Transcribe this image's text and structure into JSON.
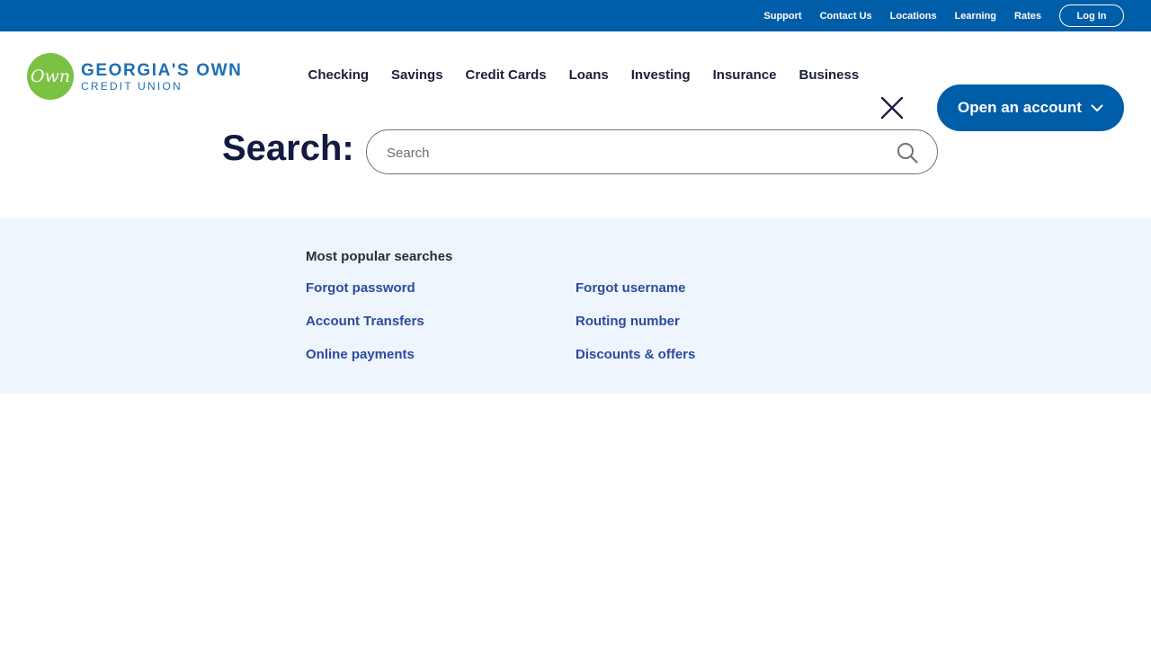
{
  "utility_nav": {
    "links": [
      "Support",
      "Contact Us",
      "Locations",
      "Learning",
      "Rates"
    ],
    "login_label": "Log In"
  },
  "brand": {
    "logo_mark": "Own",
    "name_line1": "GEORGIA'S OWN",
    "name_line2": "CREDIT UNION",
    "green": "#7bc144",
    "blue": "#005da8"
  },
  "main_nav": {
    "items": [
      "Checking",
      "Savings",
      "Credit Cards",
      "Loans",
      "Investing",
      "Insurance",
      "Business"
    ],
    "close_icon": "close-icon",
    "open_account_label": "Open an account"
  },
  "search": {
    "heading": "Search:",
    "placeholder": "Search",
    "value": "",
    "icon": "search-icon"
  },
  "popular": {
    "title": "Most popular searches",
    "left": [
      "Forgot password",
      "Account Transfers",
      "Online payments"
    ],
    "right": [
      "Forgot username",
      "Routing number",
      "Discounts & offers"
    ],
    "background": "#eef5fc",
    "link_color": "#2d49a0"
  }
}
